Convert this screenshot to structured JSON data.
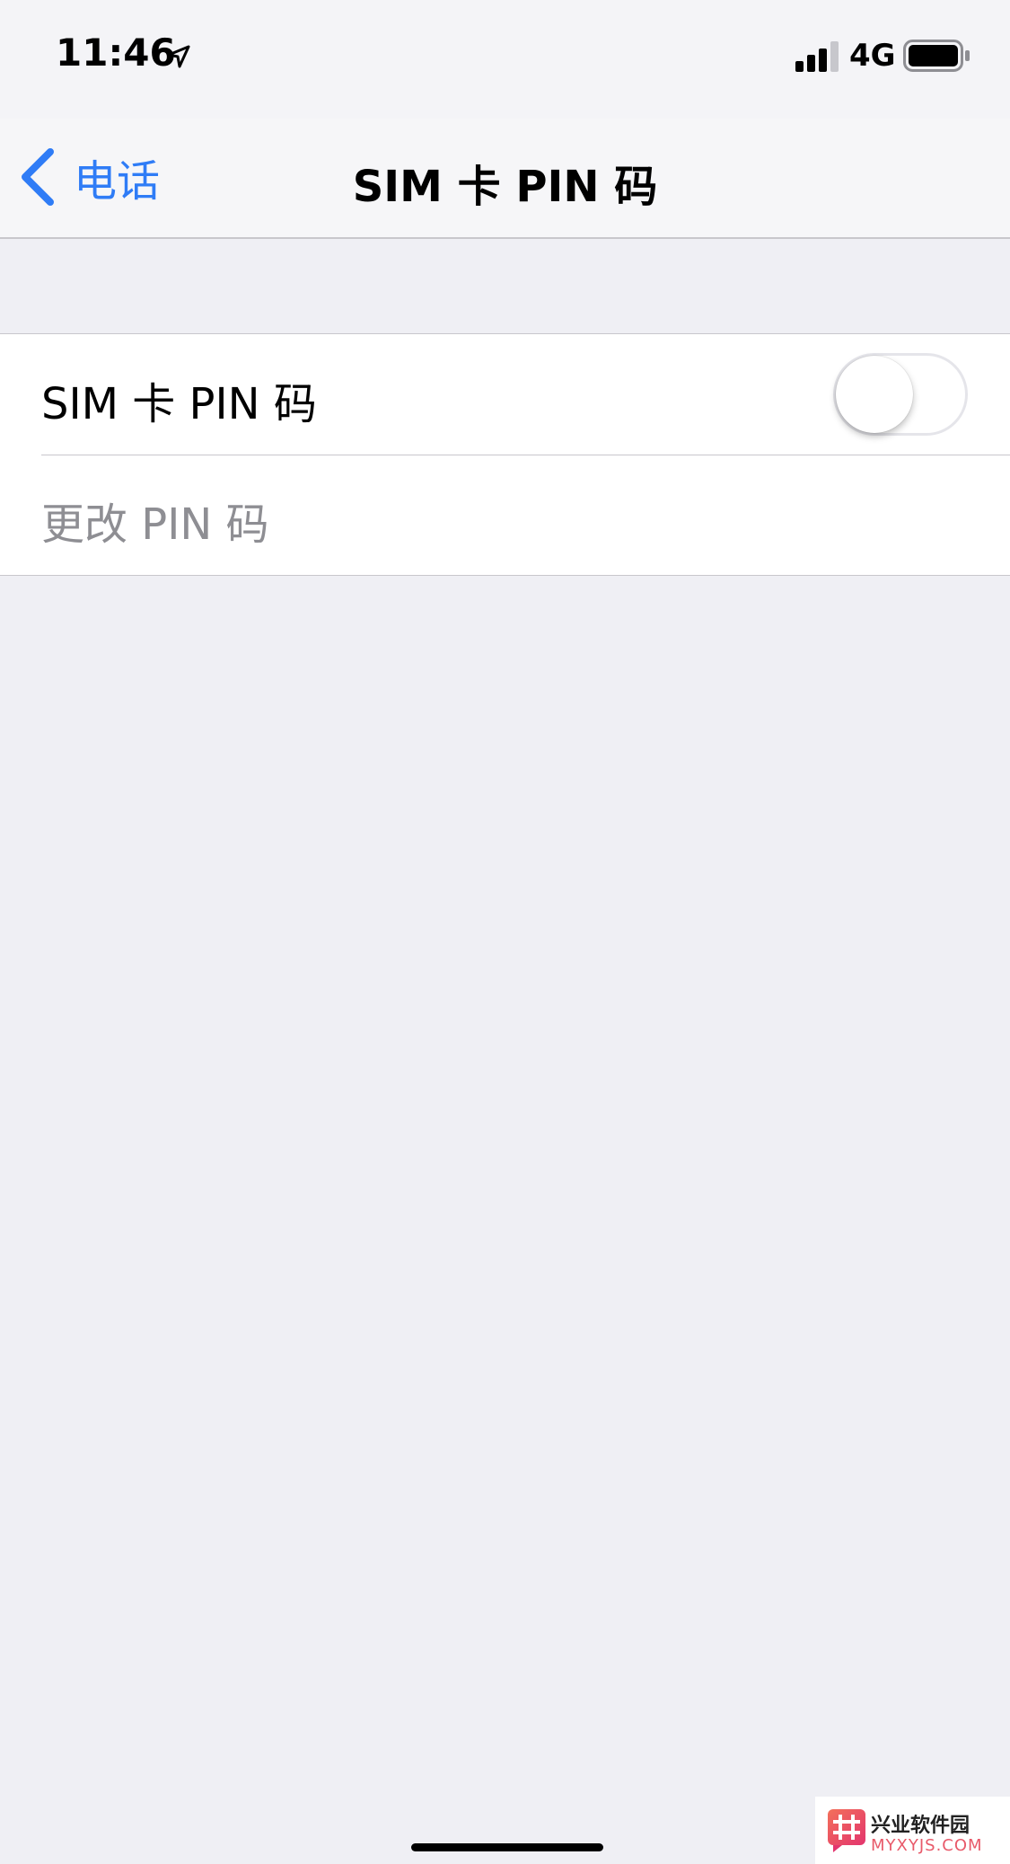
{
  "status_bar": {
    "time": "11:46",
    "network": "4G",
    "icons": [
      "location-arrow-icon",
      "cellular-signal-icon",
      "battery-icon"
    ]
  },
  "nav": {
    "back_label": "电话",
    "title": "SIM 卡 PIN 码",
    "accent_color": "#2f7cf6"
  },
  "settings": {
    "sim_pin_label": "SIM 卡 PIN 码",
    "sim_pin_enabled": false,
    "change_pin_label": "更改 PIN 码",
    "change_pin_enabled": false
  },
  "watermark": {
    "name": "兴业软件园",
    "url": "MYXYJS.COM"
  }
}
